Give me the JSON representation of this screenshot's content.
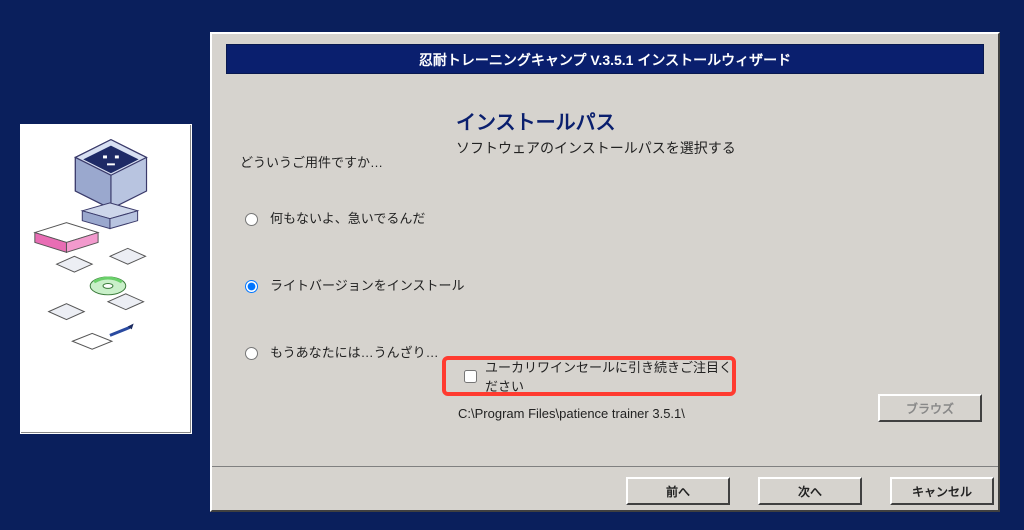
{
  "titlebar": "忍耐トレーニングキャンプ V.3.5.1 インストールウィザード",
  "heading": "インストールパス",
  "subheading": "ソフトウェアのインストールパスを選択する",
  "prompt": "どういうご用件ですか…",
  "options": [
    {
      "label": "何もないよ、急いでるんだ",
      "selected": false
    },
    {
      "label": "ライトバージョンをインストール",
      "selected": true
    },
    {
      "label": "もうあなたには…うんざり…",
      "selected": false
    }
  ],
  "checkbox": {
    "label": "ユーカリワインセールに引き続きご注目ください",
    "checked": false
  },
  "install_path": "C:\\Program Files\\patience trainer 3.5.1\\",
  "buttons": {
    "browse": "ブラウズ",
    "back": "前へ",
    "next": "次へ",
    "cancel": "キャンセル"
  }
}
